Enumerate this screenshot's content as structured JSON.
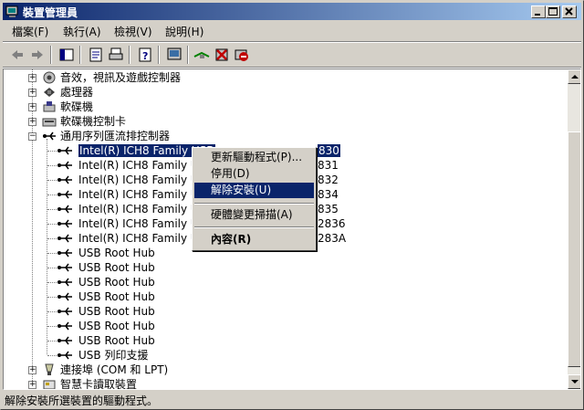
{
  "window": {
    "title": "裝置管理員"
  },
  "menubar": [
    "檔案(F)",
    "執行(A)",
    "檢視(V)",
    "說明(H)"
  ],
  "tree": {
    "top_items": [
      {
        "label": "音效，視訊及遊戲控制器",
        "icon": "sound-icon"
      },
      {
        "label": "處理器",
        "icon": "processor-icon"
      },
      {
        "label": "軟碟機",
        "icon": "floppy-drive-icon"
      },
      {
        "label": "軟碟機控制卡",
        "icon": "floppy-controller-icon"
      }
    ],
    "usb_category": "通用序列匯流排控制器",
    "usb_children": [
      "Intel(R) ICH8 Family USB",
      "Intel(R) ICH8 Family USB",
      "Intel(R) ICH8 Family USB",
      "Intel(R) ICH8 Family USB",
      "Intel(R) ICH8 Family USB",
      "Intel(R) ICH8 Family USB",
      "Intel(R) ICH8 Family USB",
      "USB Root Hub",
      "USB Root Hub",
      "USB Root Hub",
      "USB Root Hub",
      "USB Root Hub",
      "USB Root Hub",
      "USB Root Hub",
      "USB 列印支援"
    ],
    "usb_suffixes": [
      "830",
      "831",
      "832",
      "834",
      "835",
      "2836",
      "283A"
    ],
    "bottom_items": [
      {
        "label": "連接埠 (COM 和 LPT)",
        "icon": "port-icon"
      },
      {
        "label": "智慧卡讀取裝置",
        "icon": "smartcard-icon"
      }
    ]
  },
  "context_menu": {
    "items": [
      "更新驅動程式(P)...",
      "停用(D)",
      "解除安裝(U)",
      "硬體變更掃描(A)",
      "內容(R)"
    ],
    "highlighted": "解除安裝(U)"
  },
  "status": {
    "text": "解除安裝所選裝置的驅動程式。"
  },
  "colors": {
    "title_start": "#0a246a",
    "title_end": "#a6caf0",
    "selection": "#0a246a",
    "face": "#d4d0c8"
  }
}
